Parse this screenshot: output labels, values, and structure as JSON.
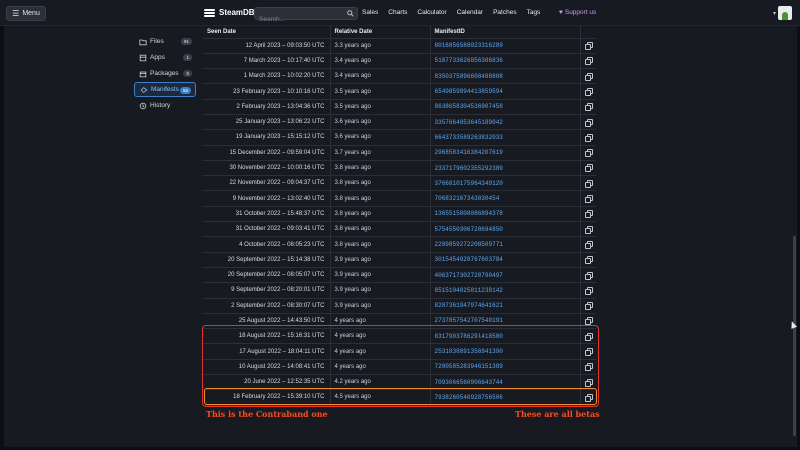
{
  "nav": {
    "menu_label": "Menu",
    "brand": "SteamDB",
    "search_placeholder": "Search...",
    "links": [
      "Sales",
      "Charts",
      "Calculator",
      "Calendar",
      "Patches",
      "Tags"
    ],
    "support_label": "Support us"
  },
  "sidebar": {
    "items": [
      {
        "label": "Files",
        "badge": "91",
        "icon": "folder-icon"
      },
      {
        "label": "Apps",
        "badge": "1",
        "icon": "apps-icon"
      },
      {
        "label": "Packages",
        "badge": "5",
        "icon": "package-icon"
      },
      {
        "label": "Manifests",
        "badge": "56",
        "icon": "manifest-icon",
        "active": true
      },
      {
        "label": "History",
        "badge": "",
        "icon": "history-icon"
      }
    ]
  },
  "table": {
    "headers": [
      "Seen Date",
      "Relative Date",
      "ManifestID",
      ""
    ],
    "rows": [
      {
        "date": "12 April 2023 – 09:03:50 UTC",
        "relative": "3.3 years ago",
        "manifest": "8016856588023316289"
      },
      {
        "date": "7 March 2023 – 10:17:40 UTC",
        "relative": "3.4 years ago",
        "manifest": "5187733626856386836"
      },
      {
        "date": "1 March 2023 – 10:02:20 UTC",
        "relative": "3.4 years ago",
        "manifest": "8350375896608488808"
      },
      {
        "date": "23 February 2023 – 10:10:16 UTC",
        "relative": "3.5 years ago",
        "manifest": "6549859894413859594"
      },
      {
        "date": "2 February 2023 – 13:04:36 UTC",
        "relative": "3.5 years ago",
        "manifest": "8638658304536907458"
      },
      {
        "date": "25 January 2023 – 13:06:22 UTC",
        "relative": "3.6 years ago",
        "manifest": "3357664853645189042"
      },
      {
        "date": "19 January 2023 – 15:15:12 UTC",
        "relative": "3.6 years ago",
        "manifest": "6643733589263832033"
      },
      {
        "date": "15 December 2022 – 09:59:04 UTC",
        "relative": "3.7 years ago",
        "manifest": "2968583416384207619"
      },
      {
        "date": "30 November 2022 – 10:00:16 UTC",
        "relative": "3.8 years ago",
        "manifest": "2337179602355292389"
      },
      {
        "date": "22 November 2022 – 09:04:37 UTC",
        "relative": "3.8 years ago",
        "manifest": "3766810175964349120"
      },
      {
        "date": "9 November 2022 – 13:02:40 UTC",
        "relative": "3.8 years ago",
        "manifest": "706832167343030454"
      },
      {
        "date": "31 October 2022 – 15:48:37 UTC",
        "relative": "3.8 years ago",
        "manifest": "1365515808086894378"
      },
      {
        "date": "31 October 2022 – 09:03:41 UTC",
        "relative": "3.8 years ago",
        "manifest": "5754550306728694850"
      },
      {
        "date": "4 October 2022 – 08:05:23 UTC",
        "relative": "3.8 years ago",
        "manifest": "2289859272208509771"
      },
      {
        "date": "20 September 2022 – 15:14:38 UTC",
        "relative": "3.9 years ago",
        "manifest": "3015454928767603784"
      },
      {
        "date": "20 September 2022 – 08:05:07 UTC",
        "relative": "3.9 years ago",
        "manifest": "4063717302720790497"
      },
      {
        "date": "9 September 2022 – 08:20:01 UTC",
        "relative": "3.9 years ago",
        "manifest": "8515104025811238142"
      },
      {
        "date": "2 September 2022 – 08:30:07 UTC",
        "relative": "3.9 years ago",
        "manifest": "8287361947974641621"
      },
      {
        "date": "25 August 2022 – 14:43:50 UTC",
        "relative": "4 years ago",
        "manifest": "2737857542707540191"
      },
      {
        "date": "18 August 2022 – 15:16:31 UTC",
        "relative": "4 years ago",
        "manifest": "831790378629l418580"
      },
      {
        "date": "17 August 2022 – 18:04:11 UTC",
        "relative": "4 years ago",
        "manifest": "2531838891356941390"
      },
      {
        "date": "10 August 2022 – 14:08:41 UTC",
        "relative": "4 years ago",
        "manifest": "7200585283946151389"
      },
      {
        "date": "20 June 2022 – 12:52:35 UTC",
        "relative": "4.2 years ago",
        "manifest": "7093066560906643744"
      },
      {
        "date": "18 February 2022 – 15:39:10 UTC",
        "relative": "4.5 years ago",
        "manifest": "7938260540928756506"
      }
    ]
  },
  "annotations": {
    "left_note": "This is the Contraband one",
    "right_note": "These are all betas",
    "red_color": "#e0322a",
    "orange_color": "#f08a2c"
  }
}
